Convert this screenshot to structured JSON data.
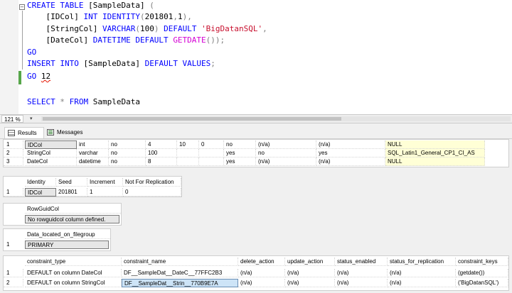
{
  "editor": {
    "lines": [
      [
        {
          "t": "CREATE TABLE ",
          "c": "kw"
        },
        {
          "t": "[SampleData]",
          "c": ""
        },
        {
          "t": " (",
          "c": "op"
        }
      ],
      [
        {
          "t": "    [IDCol] ",
          "c": ""
        },
        {
          "t": "INT IDENTITY",
          "c": "kw"
        },
        {
          "t": "(",
          "c": "op"
        },
        {
          "t": "201801",
          "c": ""
        },
        {
          "t": ",",
          "c": "op"
        },
        {
          "t": "1",
          "c": ""
        },
        {
          "t": "),",
          "c": "op"
        }
      ],
      [
        {
          "t": "    [StringCol] ",
          "c": ""
        },
        {
          "t": "VARCHAR",
          "c": "kw"
        },
        {
          "t": "(",
          "c": "op"
        },
        {
          "t": "100",
          "c": ""
        },
        {
          "t": ") ",
          "c": "op"
        },
        {
          "t": "DEFAULT ",
          "c": "kw"
        },
        {
          "t": "'BigDatanSQL'",
          "c": "str"
        },
        {
          "t": ",",
          "c": "op"
        }
      ],
      [
        {
          "t": "    [DateCol] ",
          "c": ""
        },
        {
          "t": "DATETIME DEFAULT ",
          "c": "kw"
        },
        {
          "t": "GETDATE",
          "c": "fn"
        },
        {
          "t": "());",
          "c": "op"
        }
      ],
      [
        {
          "t": "GO",
          "c": "kw"
        }
      ],
      [
        {
          "t": "INSERT INTO ",
          "c": "kw"
        },
        {
          "t": "[SampleData] ",
          "c": ""
        },
        {
          "t": "DEFAULT VALUES",
          "c": "kw"
        },
        {
          "t": ";",
          "c": "op"
        }
      ],
      [
        {
          "t": "GO ",
          "c": "kw"
        },
        {
          "t": "12",
          "c": "sq"
        }
      ],
      [],
      [
        {
          "t": "SELECT ",
          "c": "kw"
        },
        {
          "t": "* ",
          "c": "op"
        },
        {
          "t": "FROM ",
          "c": "kw"
        },
        {
          "t": "SampleData",
          "c": ""
        }
      ]
    ],
    "zoom": "121 %"
  },
  "tabs": {
    "results": "Results",
    "messages": "Messages"
  },
  "columns_grid": {
    "rows": [
      [
        "1",
        "IDCol",
        "int",
        "no",
        "4",
        "10",
        "0",
        "no",
        "(n/a)",
        "(n/a)",
        "NULL"
      ],
      [
        "2",
        "StringCol",
        "varchar",
        "no",
        "100",
        "",
        "",
        "yes",
        "no",
        "yes",
        "SQL_Latin1_General_CP1_CI_AS"
      ],
      [
        "3",
        "DateCol",
        "datetime",
        "no",
        "8",
        "",
        "",
        "yes",
        "(n/a)",
        "(n/a)",
        "NULL"
      ]
    ]
  },
  "identity_grid": {
    "headers": [
      "Identity",
      "Seed",
      "Increment",
      "Not For Replication"
    ],
    "rows": [
      [
        "1",
        "IDCol",
        "201801",
        "1",
        "0"
      ]
    ]
  },
  "rowguid_grid": {
    "header": "RowGuidCol",
    "value": "No rowguidcol column defined."
  },
  "filegroup_grid": {
    "header": "Data_located_on_filegroup",
    "value": "PRIMARY"
  },
  "constraints_grid": {
    "headers": [
      "constraint_type",
      "constraint_name",
      "delete_action",
      "update_action",
      "status_enabled",
      "status_for_replication",
      "constraint_keys"
    ],
    "rows": [
      [
        "1",
        "DEFAULT on column DateCol",
        "DF__SampleDat__DateC__77FFC2B3",
        "(n/a)",
        "(n/a)",
        "(n/a)",
        "(n/a)",
        "(getdate())"
      ],
      [
        "2",
        "DEFAULT on column StringCol",
        "DF__SampleDat__Strin__770B9E7A",
        "(n/a)",
        "(n/a)",
        "(n/a)",
        "(n/a)",
        "('BigDatanSQL')"
      ]
    ]
  },
  "colors": {
    "keyword": "#0000ff",
    "string": "#c8102e",
    "function": "#d400d4",
    "change_bar": "#57a64a",
    "highlight_yellow": "#ffffd6"
  }
}
